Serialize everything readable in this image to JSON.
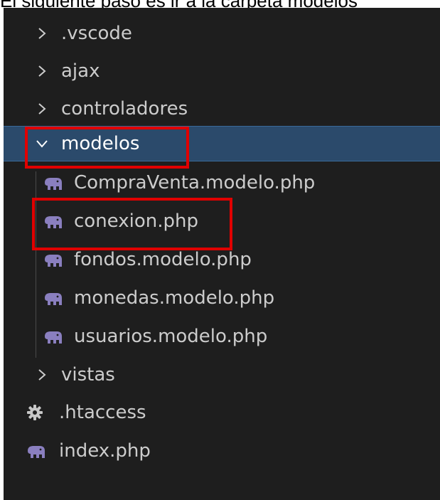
{
  "caption": "El siguiente paso es ir a la carpeta modelos",
  "explorer": {
    "folders": {
      "vscode": ".vscode",
      "ajax": "ajax",
      "controladores": "controladores",
      "modelos": "modelos",
      "vistas": "vistas"
    },
    "modelos_files": [
      "CompraVenta.modelo.php",
      "conexion.php",
      "fondos.modelo.php",
      "monedas.modelo.php",
      "usuarios.modelo.php"
    ],
    "root_files": {
      "htaccess": ".htaccess",
      "index": "index.php"
    }
  },
  "colors": {
    "php_icon": "#8a7fbf",
    "gear_icon": "#c7c7c7",
    "selection_bg": "#2b4a6b",
    "highlight": "#e00000"
  }
}
